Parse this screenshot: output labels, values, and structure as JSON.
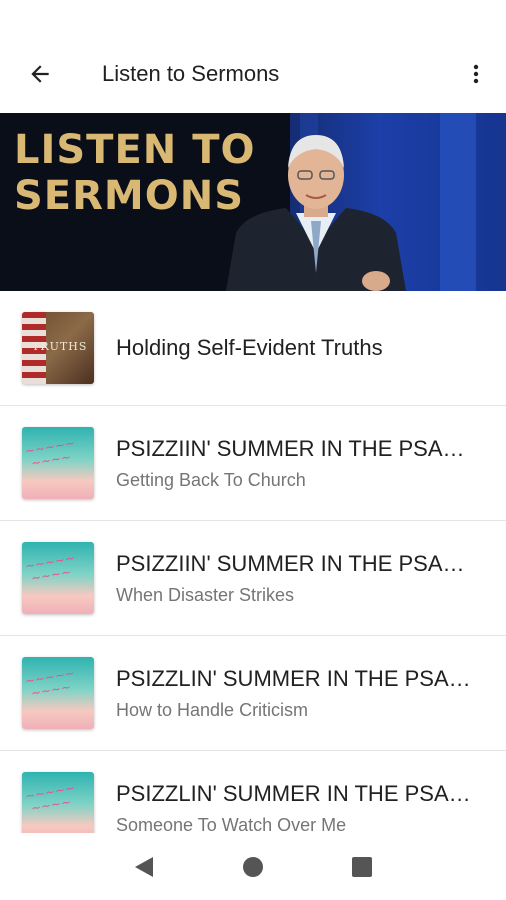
{
  "toolbar": {
    "title": "Listen to Sermons",
    "back_icon": "arrow-left-icon",
    "menu_icon": "more-vertical-icon"
  },
  "banner": {
    "line1": "LISTEN TO",
    "line2": "SERMONS"
  },
  "sermons": [
    {
      "title": "Holding Self-Evident Truths",
      "subtitle": "",
      "thumb_text": "TRUTHS"
    },
    {
      "title": "PSIZZIIN' SUMMER IN THE PSALMS",
      "subtitle": "Getting Back To Church"
    },
    {
      "title": "PSIZZIIN' SUMMER IN THE PSALMS",
      "subtitle": "When Disaster Strikes"
    },
    {
      "title": "PSIZZLIN' SUMMER IN THE PSALMS",
      "subtitle": "How to Handle Criticism"
    },
    {
      "title": "PSIZZLIN' SUMMER IN THE PSALMS",
      "subtitle": "Someone To Watch Over Me"
    }
  ],
  "nav": {
    "back_icon": "triangle-back-icon",
    "home_icon": "circle-home-icon",
    "recents_icon": "square-recents-icon"
  },
  "colors": {
    "banner_text": "#d9b874",
    "primary_text": "#212121",
    "secondary_text": "#757575"
  }
}
